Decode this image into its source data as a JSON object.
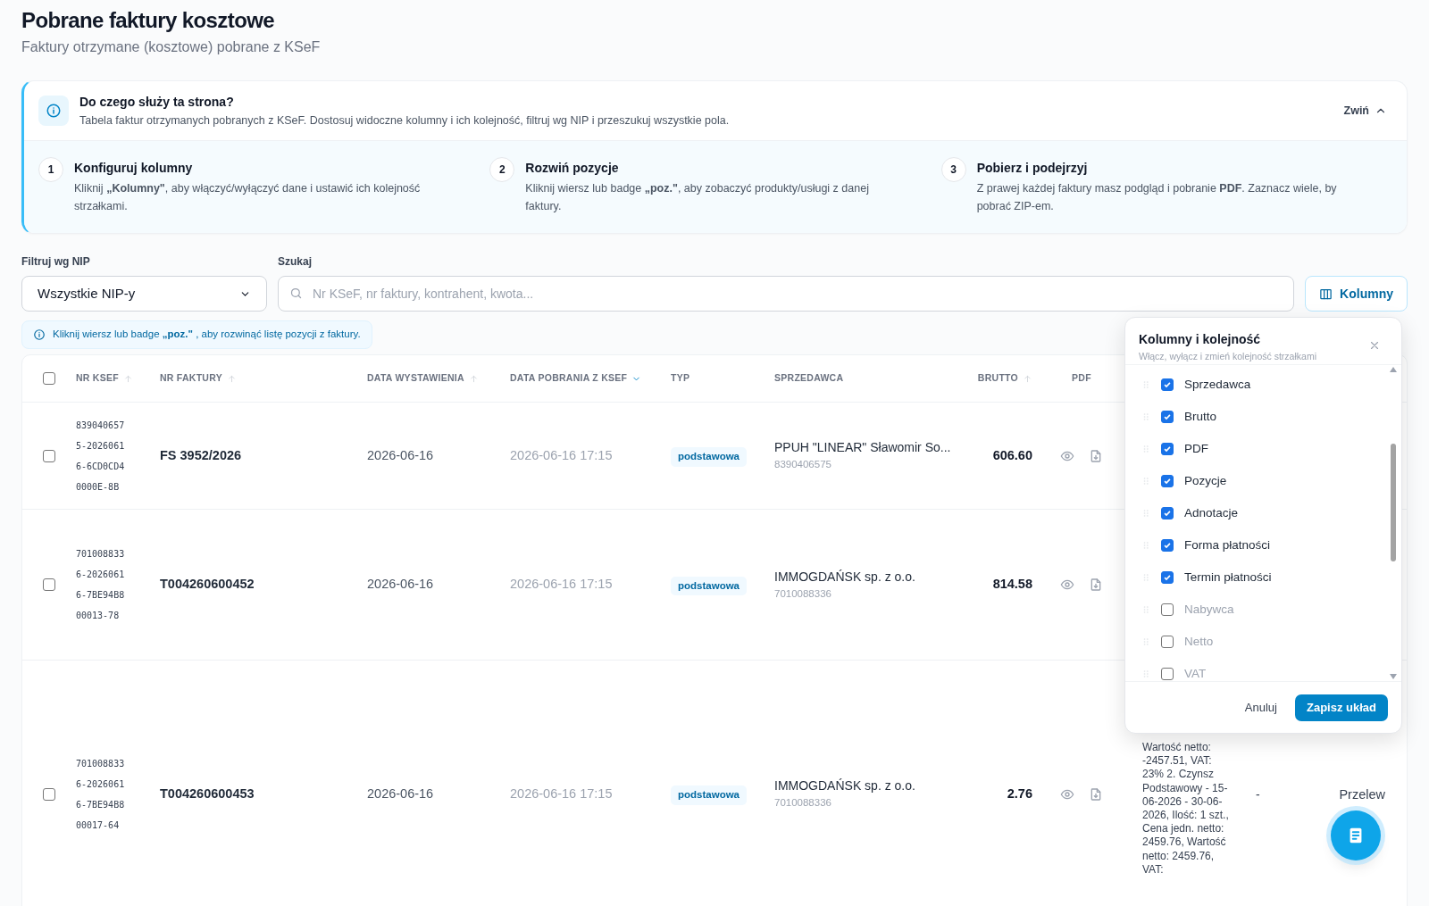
{
  "page": {
    "title": "Pobrane faktury kosztowe",
    "subtitle": "Faktury otrzymane (kosztowe) pobrane z KSeF"
  },
  "info": {
    "title": "Do czego służy ta strona?",
    "text": "Tabela faktur otrzymanych pobranych z KSeF. Dostosuj widoczne kolumny i ich kolejność, filtruj wg NIP i przeszukuj wszystkie pola.",
    "collapse_label": "Zwiń",
    "expanded": true,
    "steps": [
      {
        "number": "1",
        "title": "Konfiguruj kolumny",
        "text": "Kliknij **„Kolumny\"**, aby włączyć/wyłączyć dane i ustawić ich kolejność strzałkami."
      },
      {
        "number": "2",
        "title": "Rozwiń pozycje",
        "text": "Kliknij wiersz lub badge **„poz.\"**, aby zobaczyć produkty/usługi z danej faktury."
      },
      {
        "number": "3",
        "title": "Pobierz i podejrzyj",
        "text": "Z prawej każdej faktury masz podgląd i pobranie **PDF**. Zaznacz wiele, by pobrać ZIP-em."
      }
    ]
  },
  "filters": {
    "nip_label": "Filtruj wg NIP",
    "nip_value": "Wszystkie NIP-y",
    "search_label": "Szukaj",
    "search_placeholder": "Nr KSeF, nr faktury, kontrahent, kwota...",
    "columns_button": "Kolumny"
  },
  "hint": "Kliknij wiersz lub badge **„poz.\"** , aby rozwinąć listę pozycji z faktury.",
  "table": {
    "select_all_checked": false,
    "columns": [
      {
        "label": "NR KSEF",
        "sortable": true,
        "sorted": false
      },
      {
        "label": "NR FAKTURY",
        "sortable": true,
        "sorted": false
      },
      {
        "label": "DATA WYSTAWIENIA",
        "sortable": true,
        "sorted": false
      },
      {
        "label": "DATA POBRANIA Z KSEF",
        "sortable": true,
        "sorted": true
      },
      {
        "label": "TYP",
        "sortable": false,
        "sorted": false
      },
      {
        "label": "SPRZEDAWCA",
        "sortable": false,
        "sorted": false
      },
      {
        "label": "BRUTTO",
        "sortable": true,
        "sorted": false
      },
      {
        "label": "PDF",
        "sortable": false,
        "sorted": false
      }
    ],
    "rows": [
      {
        "checked": false,
        "ksef": [
          "839040657",
          "5-2026061",
          "6-6CD0CD4",
          "0000E-8B"
        ],
        "invoice": "FS 3952/2026",
        "issue_date": "2026-06-16",
        "download_date": "2026-06-16 17:15",
        "type": "podstawowa",
        "seller": "PPUH \"LINEAR\" Sławomir So...",
        "seller_nip": "8390406575",
        "gross": "606.60"
      },
      {
        "checked": false,
        "ksef": [
          "701008833",
          "6-2026061",
          "6-7BE94B8",
          "00013-78"
        ],
        "invoice": "T004260600452",
        "issue_date": "2026-06-16",
        "download_date": "2026-06-16 17:15",
        "type": "podstawowa",
        "seller": "IMMOGDAŃSK sp. z o.o.",
        "seller_nip": "7010088336",
        "gross": "814.58"
      },
      {
        "checked": false,
        "ksef": [
          "701008833",
          "6-2026061",
          "6-7BE94B8",
          "00017-64"
        ],
        "invoice": "T004260600453",
        "issue_date": "2026-06-16",
        "download_date": "2026-06-16 17:15",
        "type": "podstawowa",
        "seller": "IMMOGDAŃSK sp. z o.o.",
        "seller_nip": "7010088336",
        "gross": "2.76",
        "pozycje": "Wartość netto: -2457.51, VAT: 23% 2. Czynsz Podstawowy - 15-06-2026 - 30-06-2026, Ilość: 1 szt., Cena jedn. netto: 2459.76, Wartość netto: 2459.76, VAT:",
        "adnotacje": "-",
        "forma_platnosci": "Przelew"
      }
    ]
  },
  "columns_panel": {
    "title": "Kolumny i kolejność",
    "subtitle": "Włącz, wyłącz i zmień kolejność strzałkami",
    "items": [
      {
        "label": "Sprzedawca",
        "checked": true
      },
      {
        "label": "Brutto",
        "checked": true
      },
      {
        "label": "PDF",
        "checked": true
      },
      {
        "label": "Pozycje",
        "checked": true
      },
      {
        "label": "Adnotacje",
        "checked": true
      },
      {
        "label": "Forma płatności",
        "checked": true
      },
      {
        "label": "Termin płatności",
        "checked": true
      },
      {
        "label": "Nabywca",
        "checked": false
      },
      {
        "label": "Netto",
        "checked": false
      },
      {
        "label": "VAT",
        "checked": false
      }
    ],
    "cancel": "Anuluj",
    "save": "Zapisz układ"
  }
}
